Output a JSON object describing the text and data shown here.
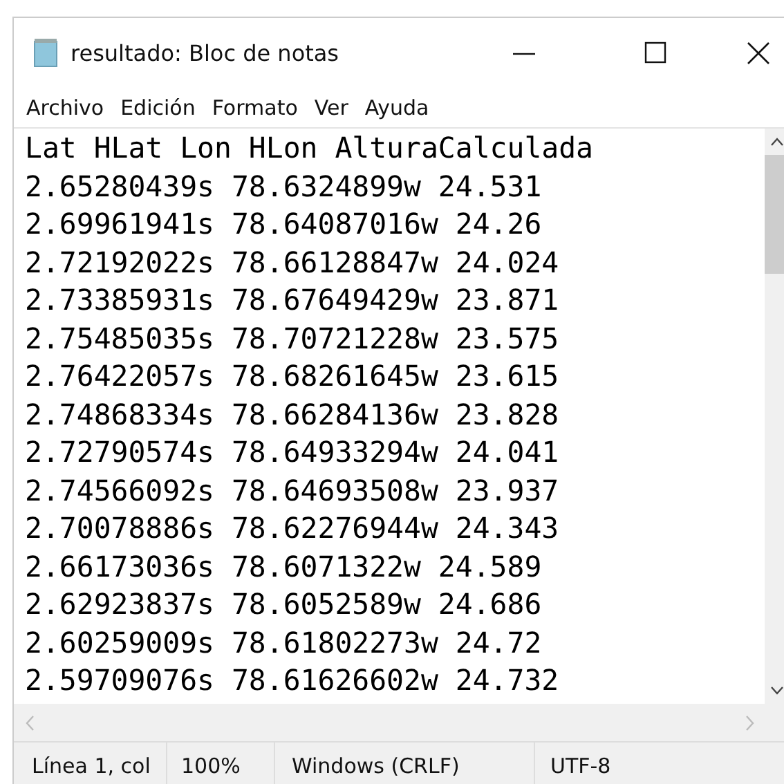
{
  "window": {
    "title": "resultado: Bloc de notas"
  },
  "menu": [
    "Archivo",
    "Edición",
    "Formato",
    "Ver",
    "Ayuda"
  ],
  "editor": {
    "lines": [
      "Lat HLat Lon HLon AlturaCalculada",
      "2.65280439s 78.6324899w 24.531",
      "2.69961941s 78.64087016w 24.26",
      "2.72192022s 78.66128847w 24.024",
      "2.73385931s 78.67649429w 23.871",
      "2.75485035s 78.70721228w 23.575",
      "2.76422057s 78.68261645w 23.615",
      "2.74868334s 78.66284136w 23.828",
      "2.72790574s 78.64933294w 24.041",
      "2.74566092s 78.64693508w 23.937",
      "2.70078886s 78.62276944w 24.343",
      "2.66173036s 78.6071322w 24.589",
      "2.62923837s 78.6052589w 24.686",
      "2.60259009s 78.61802273w 24.72",
      "2.59709076s 78.61626602w 24.732"
    ]
  },
  "status_bar": [
    "Línea 1, col",
    "100%",
    "Windows (CRLF)",
    "UTF-8"
  ]
}
